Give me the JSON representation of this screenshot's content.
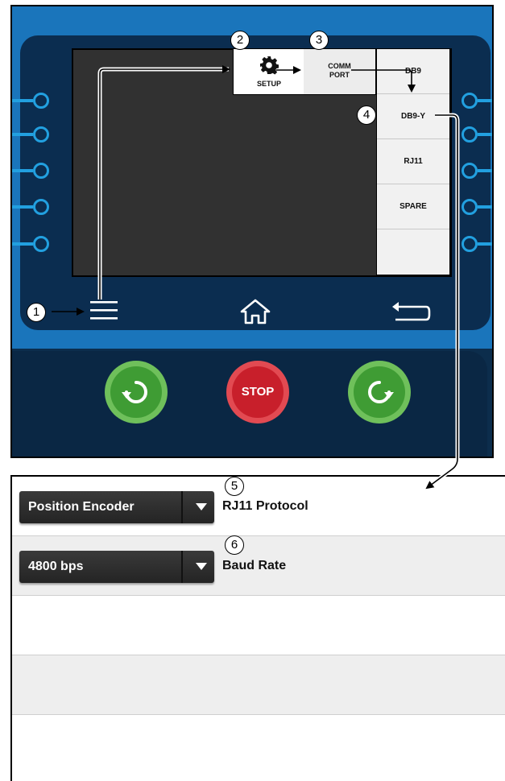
{
  "device": {
    "menu": {
      "setup_label": "SETUP",
      "comm_port_line1": "COMM",
      "comm_port_line2": "PORT",
      "items": [
        {
          "label": "DB9"
        },
        {
          "label": "DB9-Y"
        },
        {
          "label": "RJ11"
        },
        {
          "label": "SPARE"
        },
        {
          "label": ""
        }
      ]
    },
    "nav": {
      "menu_icon": "hamburger-icon",
      "home_icon": "home-icon",
      "back_icon": "back-arrow-icon"
    },
    "controls": {
      "ccw_icon": "rotate-counterclockwise-icon",
      "stop_label": "STOP",
      "cw_icon": "rotate-clockwise-icon"
    },
    "colors": {
      "panel_blue": "#1a75bb",
      "panel_navy": "#0c2d4c",
      "led_blue": "#22a0e0",
      "go_green": "#58b944",
      "stop_red": "#d0202e"
    }
  },
  "callouts": [
    "1",
    "2",
    "3",
    "4",
    "5",
    "6"
  ],
  "settings": {
    "rows": [
      {
        "value": "Position Encoder",
        "label": "RJ11 Protocol"
      },
      {
        "value": "4800 bps",
        "label": "Baud Rate"
      },
      {
        "value": "",
        "label": ""
      },
      {
        "value": "",
        "label": ""
      },
      {
        "value": "",
        "label": ""
      }
    ]
  }
}
